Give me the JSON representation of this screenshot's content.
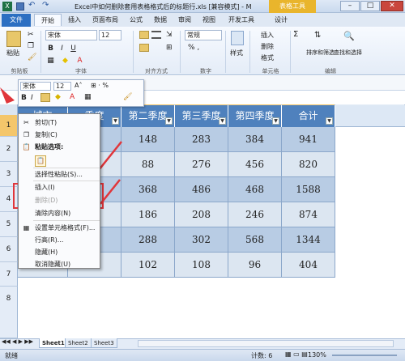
{
  "window": {
    "title": "Excel中如何删除套用表格格式后的标题行.xls [兼容模式] - M",
    "context_tab": "表格工具",
    "min": "–",
    "max": "□",
    "close": "✕"
  },
  "tabs": [
    "文件",
    "开始",
    "插入",
    "页面布局",
    "公式",
    "数据",
    "审阅",
    "视图",
    "开发工具",
    "设计"
  ],
  "ribbon": {
    "paste": "粘贴",
    "font_name": "宋体",
    "font_size": "12",
    "number_format": "常规",
    "style": "样式",
    "insert": "插入",
    "delete": "删除",
    "format": "格式",
    "sort_filter": "排序和筛选",
    "find_select": "查找和选择",
    "groups": [
      "剪贴板",
      "字体",
      "对齐方式",
      "数字",
      "单元格",
      "编辑"
    ]
  },
  "mini_toolbar": {
    "font_name": "宋体",
    "font_size": "12"
  },
  "columns": [
    "B",
    "C",
    "D",
    "E",
    "F",
    "G"
  ],
  "row_numbers": [
    "1",
    "2",
    "3",
    "4",
    "5",
    "6",
    "7",
    "8"
  ],
  "table": {
    "headers": [
      "城市",
      "第一季度",
      "第二季度",
      "第三季度",
      "第四季度",
      "合计"
    ],
    "visible_headers": [
      "第一季度",
      "第二季度",
      "第三季度",
      "第四季度",
      "合计"
    ],
    "header_partial_b": "城市",
    "header_partial_c": "季度",
    "col_c_partial": [
      "6",
      "6",
      "5",
      "5",
      "6"
    ],
    "rows": [
      [
        "148",
        "283",
        "384",
        "941"
      ],
      [
        "88",
        "276",
        "456",
        "820"
      ],
      [
        "368",
        "486",
        "468",
        "1588"
      ],
      [
        "186",
        "208",
        "246",
        "874"
      ],
      [
        "288",
        "302",
        "568",
        "1344"
      ],
      [
        "102",
        "108",
        "96",
        "404"
      ]
    ]
  },
  "context_menu": {
    "items": [
      {
        "label": "剪切(T)",
        "icon": "✂",
        "disabled": false
      },
      {
        "label": "复制(C)",
        "icon": "❐",
        "disabled": false
      },
      {
        "label": "粘贴选项:",
        "icon": "📋",
        "disabled": false
      },
      {
        "label": "",
        "icon": "📋",
        "disabled": false
      },
      {
        "label": "选择性粘贴(S)...",
        "icon": "",
        "disabled": false
      },
      {
        "label": "插入(I)",
        "icon": "",
        "disabled": false
      },
      {
        "label": "删除(D)",
        "icon": "",
        "disabled": true
      },
      {
        "label": "清除内容(N)",
        "icon": "",
        "disabled": false
      },
      {
        "label": "设置单元格格式(F)...",
        "icon": "▦",
        "disabled": false
      },
      {
        "label": "行高(R)...",
        "icon": "",
        "disabled": false
      },
      {
        "label": "隐藏(H)",
        "icon": "",
        "disabled": false
      },
      {
        "label": "取消隐藏(U)",
        "icon": "",
        "disabled": false
      }
    ]
  },
  "sheets": [
    "Sheet1",
    "Sheet2",
    "Sheet3"
  ],
  "status": {
    "ready": "就绪",
    "count": "计数: 6",
    "zoom": "130%"
  },
  "colors": {
    "header_blue": "#4f81bd",
    "band_light": "#dce6f1",
    "band_mid": "#b8cce4",
    "highlight_red": "#e0363b"
  }
}
